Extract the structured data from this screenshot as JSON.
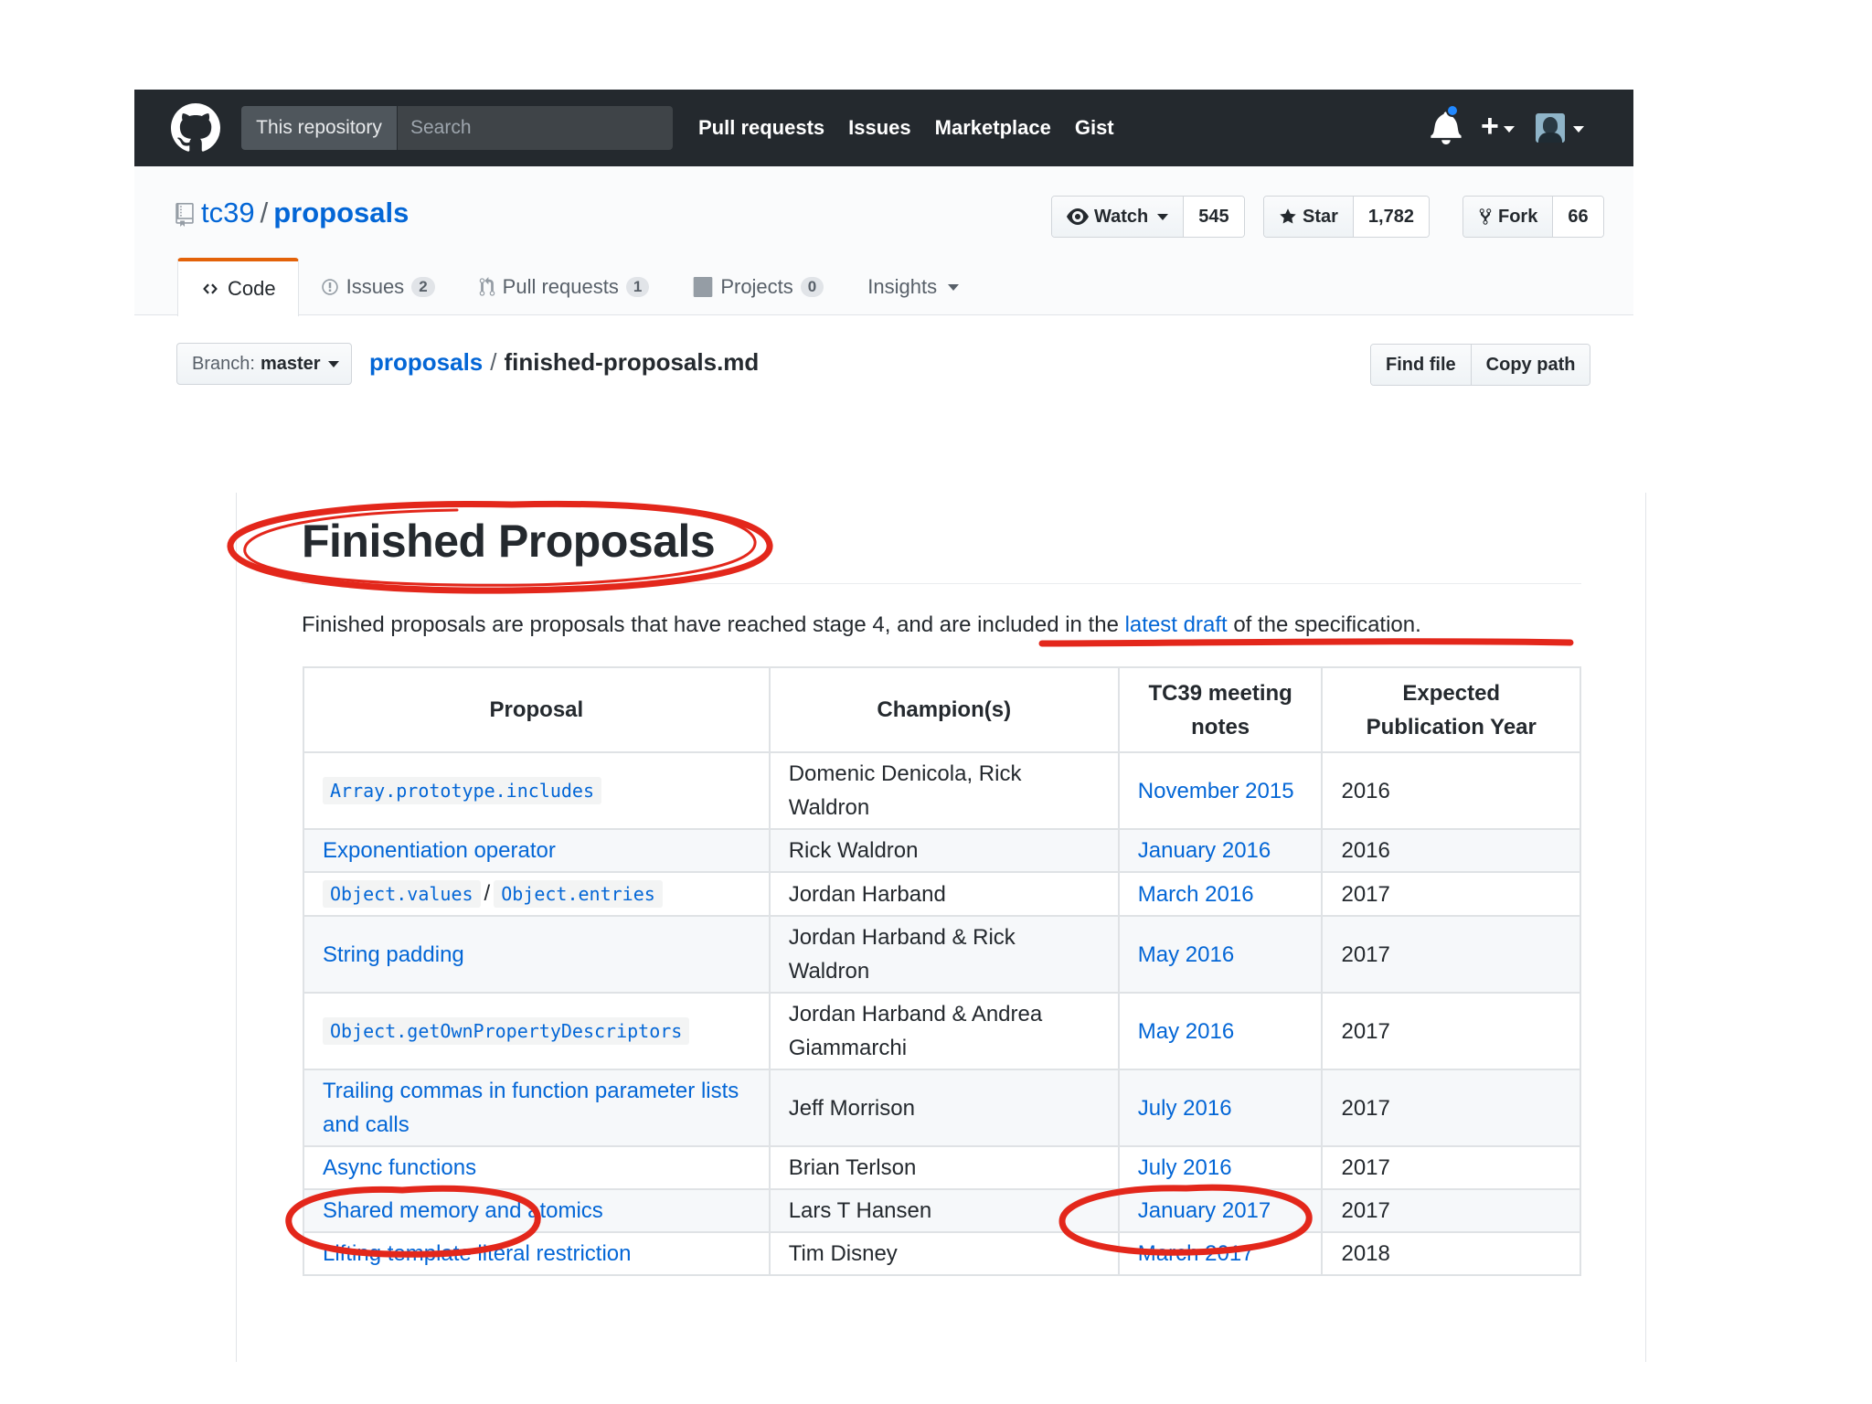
{
  "header": {
    "scope_label": "This repository",
    "search_placeholder": "Search",
    "nav": [
      "Pull requests",
      "Issues",
      "Marketplace",
      "Gist"
    ],
    "plus_label": "+"
  },
  "repo": {
    "owner": "tc39",
    "separator": "/",
    "name": "proposals",
    "watch": {
      "label": "Watch",
      "count": "545"
    },
    "star": {
      "label": "Star",
      "count": "1,782"
    },
    "fork": {
      "label": "Fork",
      "count": "66"
    }
  },
  "tabs": {
    "code": {
      "label": "Code"
    },
    "issues": {
      "label": "Issues",
      "count": "2"
    },
    "pulls": {
      "label": "Pull requests",
      "count": "1"
    },
    "projects": {
      "label": "Projects",
      "count": "0"
    },
    "insights": {
      "label": "Insights"
    }
  },
  "filenav": {
    "branch_prefix": "Branch:",
    "branch": "master",
    "crumb_root": "proposals",
    "crumb_sep": "/",
    "crumb_file": "finished-proposals.md",
    "find_file": "Find file",
    "copy_path": "Copy path"
  },
  "content": {
    "title": "Finished Proposals",
    "para_before": "Finished proposals are proposals that have reached stage 4, and are included in the ",
    "para_link": "latest draft",
    "para_after": " of the specification.",
    "table": {
      "headers": [
        "Proposal",
        "Champion(s)",
        "TC39 meeting notes",
        "Expected Publication Year"
      ],
      "rows": [
        {
          "proposal": "Array.prototype.includes",
          "champions": "Domenic Denicola, Rick Waldron",
          "notes": "November 2015",
          "year": "2016"
        },
        {
          "proposal": "Exponentiation operator",
          "champions": "Rick Waldron",
          "notes": "January 2016",
          "year": "2016"
        },
        {
          "proposal_a": "Object.values",
          "proposal_sep": "/",
          "proposal_b": "Object.entries",
          "champions": "Jordan Harband",
          "notes": "March 2016",
          "year": "2017"
        },
        {
          "proposal": "String padding",
          "champions": "Jordan Harband & Rick Waldron",
          "notes": "May 2016",
          "year": "2017"
        },
        {
          "proposal": "Object.getOwnPropertyDescriptors",
          "champions": "Jordan Harband & Andrea Giammarchi",
          "notes": "May 2016",
          "year": "2017"
        },
        {
          "proposal": "Trailing commas in function parameter lists and calls",
          "champions": "Jeff Morrison",
          "notes": "July 2016",
          "year": "2017"
        },
        {
          "proposal": "Async functions",
          "champions": "Brian Terlson",
          "notes": "July 2016",
          "year": "2017"
        },
        {
          "proposal": "Shared memory and atomics",
          "champions": "Lars T Hansen",
          "notes": "January 2017",
          "year": "2017"
        },
        {
          "proposal": "Lifting template literal restriction",
          "champions": "Tim Disney",
          "notes": "March 2017",
          "year": "2018"
        }
      ]
    }
  },
  "colors": {
    "header_bg": "#24292e",
    "link": "#0366d6",
    "annotation_red": "#e3271b",
    "tab_accent": "#e36209",
    "notification": "#2188ff"
  },
  "icons": [
    "github-logo-icon",
    "bell-icon",
    "plus-icon",
    "avatar",
    "repo-icon",
    "eye-icon",
    "star-icon",
    "fork-icon",
    "code-icon",
    "issue-icon",
    "pull-request-icon",
    "project-icon",
    "caret-down-icon"
  ]
}
